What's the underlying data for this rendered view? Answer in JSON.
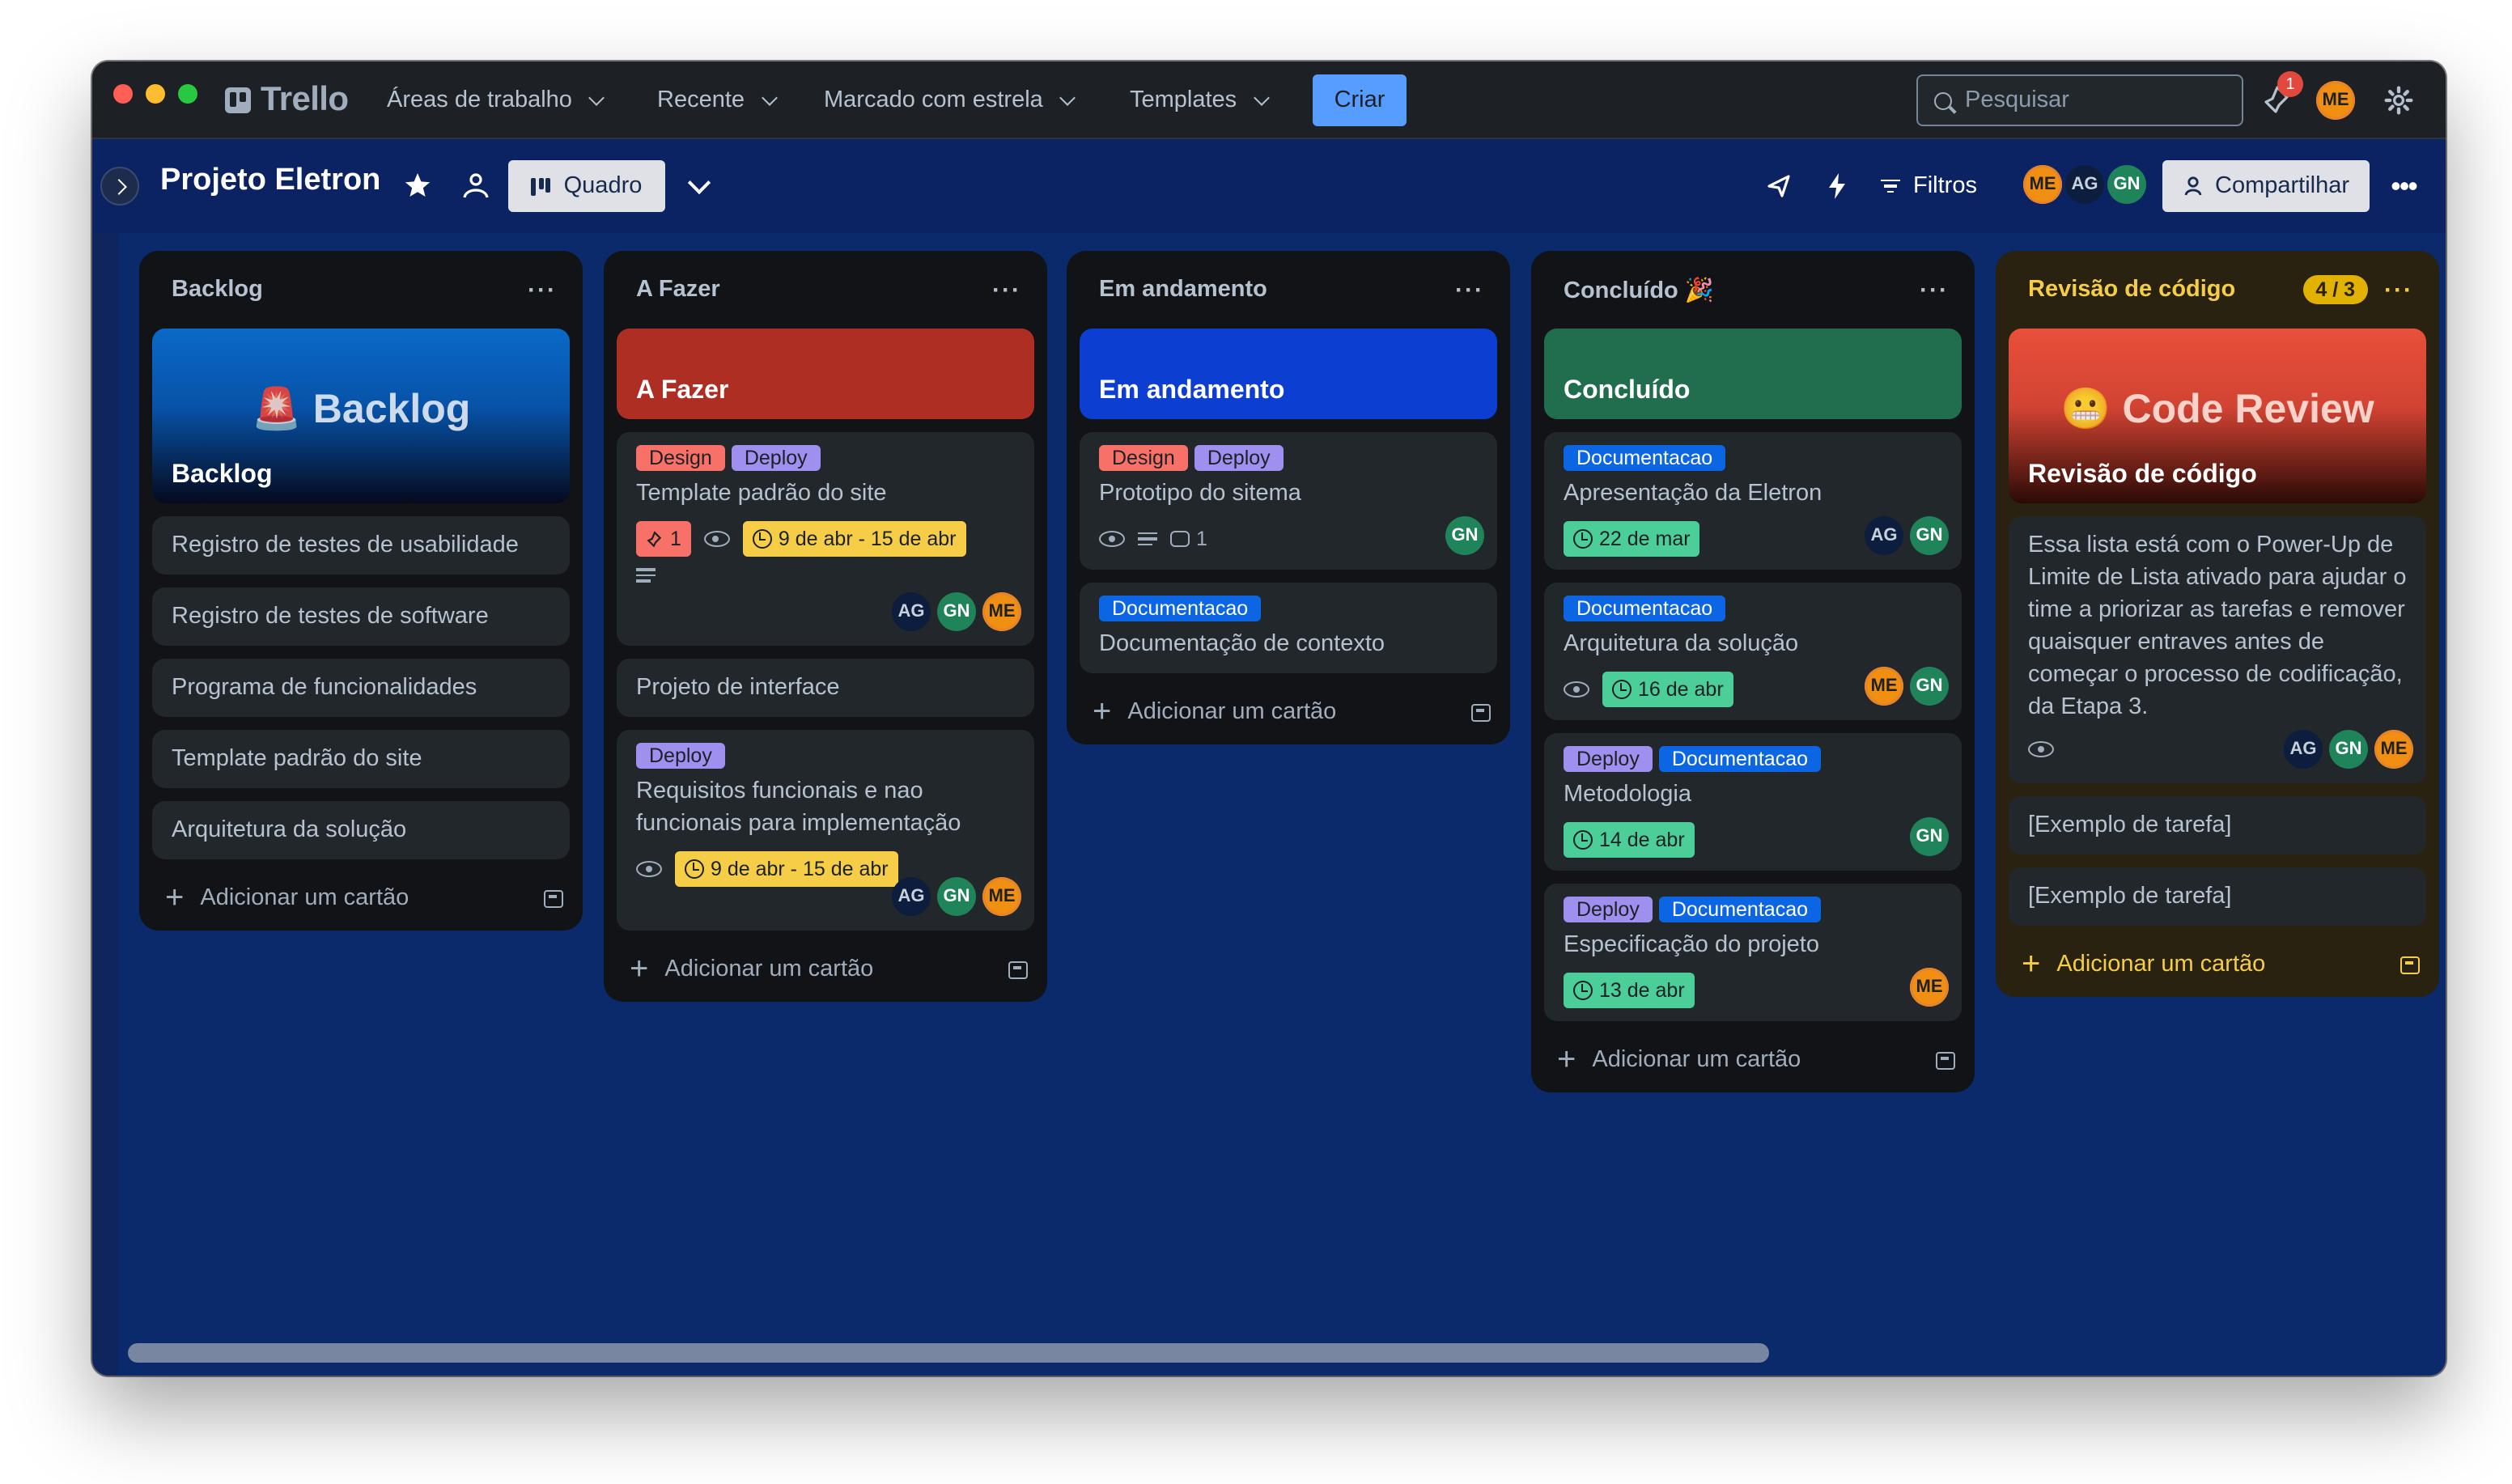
{
  "topbar": {
    "logo": "Trello",
    "nav": [
      "Áreas de trabalho",
      "Recente",
      "Marcado com estrela",
      "Templates"
    ],
    "create": "Criar",
    "search_placeholder": "Pesquisar",
    "notifications": "1",
    "user": "ME"
  },
  "board": {
    "title": "Projeto Eletron",
    "view": "Quadro",
    "filters": "Filtros",
    "members": [
      "ME",
      "AG",
      "GN"
    ],
    "share": "Compartilhar"
  },
  "lists": [
    {
      "title": "Backlog",
      "hero": {
        "art": "🚨 Backlog",
        "label": "Backlog"
      },
      "cards": [
        "Registro de testes de usabilidade",
        "Registro de testes de software",
        "Programa de funcionalidades",
        "Template padrão do site",
        "Arquitetura da solução"
      ],
      "add": "Adicionar um cartão"
    },
    {
      "title": "A Fazer",
      "cover": "A Fazer",
      "cards": [
        {
          "labels": [
            "Design",
            "Deploy"
          ],
          "title": "Template padrão do site",
          "red_badge": "1",
          "date": "9 de abr - 15 de abr",
          "members": [
            "AG",
            "GN",
            "ME"
          ]
        },
        {
          "title": "Projeto de interface"
        },
        {
          "labels": [
            "Deploy"
          ],
          "title": "Requisitos funcionais e nao funcionais para implementação",
          "date": "9 de abr - 15 de abr",
          "members": [
            "AG",
            "GN",
            "ME"
          ]
        }
      ],
      "add": "Adicionar um cartão"
    },
    {
      "title": "Em andamento",
      "cover": "Em andamento",
      "cards": [
        {
          "labels": [
            "Design",
            "Deploy"
          ],
          "title": "Prototipo do sitema",
          "comments": "1",
          "members": [
            "GN"
          ]
        },
        {
          "labels": [
            "Documentacao"
          ],
          "title": "Documentação de contexto"
        }
      ],
      "add": "Adicionar um cartão"
    },
    {
      "title": "Concluído 🎉",
      "cover": "Concluído",
      "cards": [
        {
          "labels": [
            "Documentacao"
          ],
          "title": "Apresentação da Eletron",
          "date": "22 de mar",
          "members": [
            "AG",
            "GN"
          ]
        },
        {
          "labels": [
            "Documentacao"
          ],
          "title": "Arquitetura da solução",
          "date": "16 de abr",
          "members": [
            "ME",
            "GN"
          ]
        },
        {
          "labels": [
            "Deploy",
            "Documentacao"
          ],
          "title": "Metodologia",
          "date": "14 de abr",
          "members": [
            "GN"
          ]
        },
        {
          "labels": [
            "Deploy",
            "Documentacao"
          ],
          "title": "Especificação do projeto",
          "date": "13 de abr",
          "members": [
            "ME"
          ]
        }
      ],
      "add": "Adicionar um cartão"
    },
    {
      "title": "Revisão de código",
      "limit": "4 / 3",
      "hero": {
        "art": "😬 Code Review",
        "label": "Revisão de código"
      },
      "cards": [
        {
          "title": "Essa lista está com o Power-Up de Limite de Lista ativado para ajudar o time a priorizar as tarefas e remover quaisquer entraves antes de começar o processo de codificação, da Etapa 3.",
          "members": [
            "AG",
            "GN",
            "ME"
          ]
        },
        {
          "title": "[Exemplo de tarefa]"
        },
        {
          "title": "[Exemplo de tarefa]"
        }
      ],
      "add": "Adicionar um cartão"
    }
  ],
  "colors": {
    "cover_red": "#ae2e24",
    "cover_blue": "#0c3fd1",
    "cover_green": "#216e4e",
    "label_design": "#f87168",
    "label_deploy": "#9f8fef",
    "label_doc": "#0c66e4",
    "date_yellow": "#f5cd47",
    "date_green": "#4bce97"
  }
}
